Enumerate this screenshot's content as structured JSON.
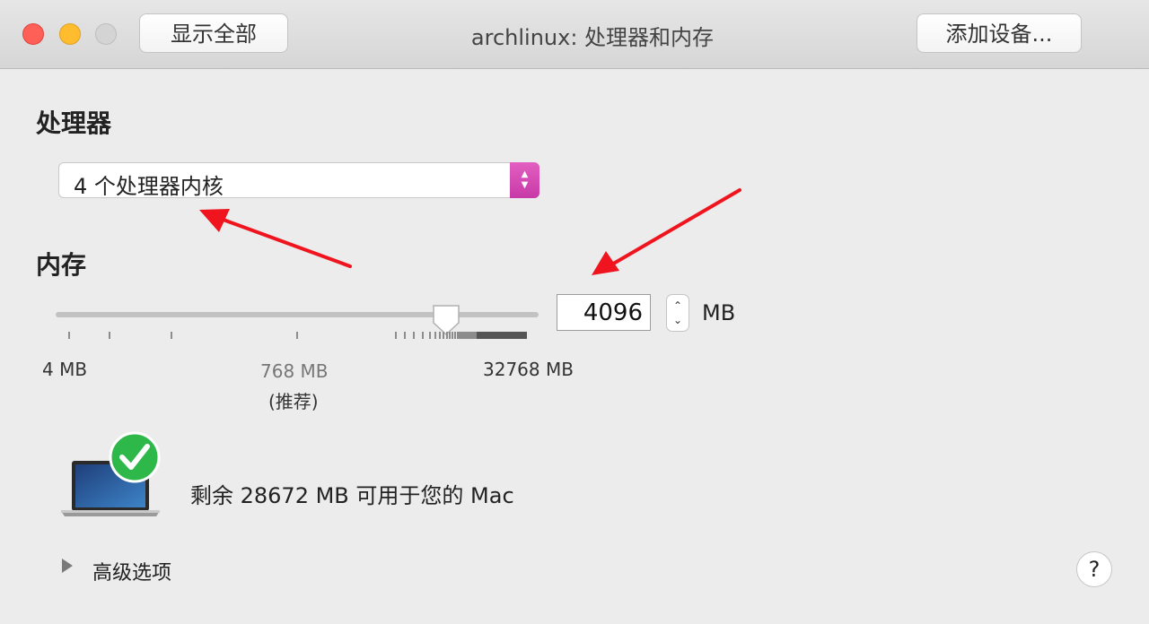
{
  "window": {
    "title": "archlinux: 处理器和内存",
    "show_all_label": "显示全部",
    "add_device_label": "添加设备..."
  },
  "processor": {
    "heading": "处理器",
    "selected": "4 个处理器内核"
  },
  "memory": {
    "heading": "内存",
    "min_label": "4 MB",
    "recommended_label": "768 MB",
    "recommended_note": "(推荐)",
    "max_label": "32768 MB",
    "value": "4096",
    "unit": "MB",
    "remaining_text": "剩余 28672 MB 可用于您的 Mac"
  },
  "advanced": {
    "label": "高级选项"
  },
  "help": {
    "label": "?"
  },
  "icons": [
    "close-button",
    "minimize-button",
    "zoom-button",
    "popup-arrows-icon",
    "slider-thumb",
    "stepper-icon",
    "macbook-icon",
    "checkmark-badge-icon",
    "disclosure-triangle-icon",
    "help-icon",
    "annotation-arrow"
  ],
  "colors": {
    "accent_popup": "#d24bb4",
    "annotation_arrow": "#f0141e",
    "check_green": "#2eb84a"
  }
}
